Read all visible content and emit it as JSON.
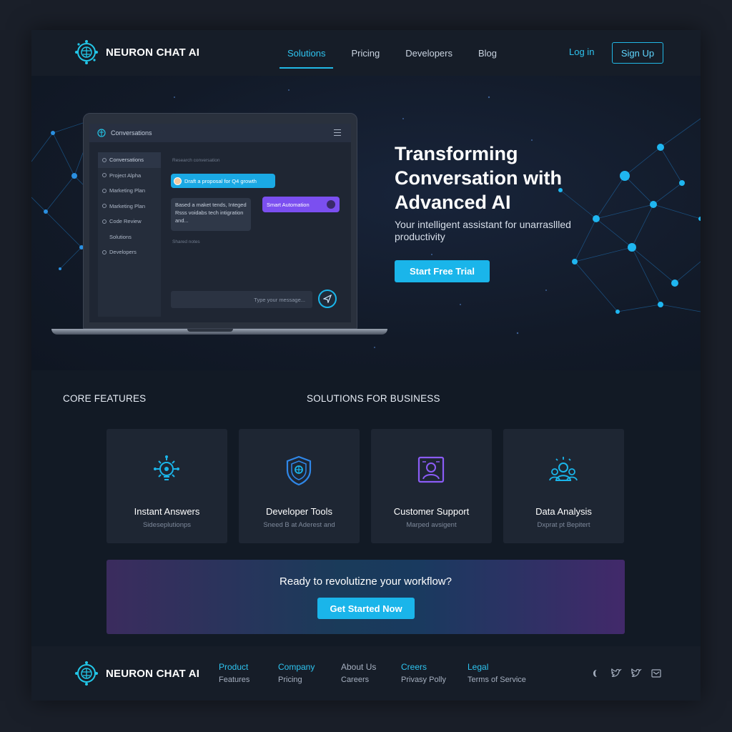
{
  "brand": {
    "name": "NEURON CHAT AI"
  },
  "nav": {
    "links": [
      "Solutions",
      "Pricing",
      "Developers",
      "Blog"
    ],
    "active": "Solutions",
    "login": "Log in",
    "signup": "Sign Up"
  },
  "hero": {
    "title": "Transforming Conversation with Advanced AI",
    "subtitle": "Your intelligent assistant for unarrasllled productivity",
    "cta": "Start Free Trial"
  },
  "app_mock": {
    "title": "Conversations",
    "sidebar": [
      "Conversations",
      "Project Alpha",
      "Marketing Plan",
      "Marketing Plan",
      "Code Review",
      "Solutions",
      "Developers"
    ],
    "chat_hint": "Research conversation",
    "user_message": "Draft a proposal for Q4 growth",
    "ai_message": "Based a maket tends, Integed Rsss voidabs tech intigration and...",
    "automation_chip": "Smart Automation",
    "small_note": "Shared notes",
    "input_placeholder": "Type your message..."
  },
  "features": {
    "label_left": "CORE FEATURES",
    "label_right": "SOLUTIONS FOR BUSINESS",
    "cards": [
      {
        "title": "Instant Answers",
        "sub": "Sideseplutionps",
        "icon": "bulb-network-icon"
      },
      {
        "title": "Developer Tools",
        "sub": "Sneed B at Aderest and",
        "icon": "shield-brain-icon"
      },
      {
        "title": "Customer Support",
        "sub": "Marped avsigent",
        "icon": "agent-screen-icon"
      },
      {
        "title": "Data Analysis",
        "sub": "Dxprat pt Bepitert",
        "icon": "team-network-icon"
      }
    ]
  },
  "cta_band": {
    "text": "Ready to revolutizne your workflow?",
    "button": "Get Started Now"
  },
  "footer": {
    "brand": "NEURON CHAT AI",
    "columns": [
      {
        "head": "Product",
        "item": "Features"
      },
      {
        "head": "Company",
        "item": "Pricing"
      },
      {
        "head": "About Us",
        "item": "Careers"
      },
      {
        "head": "Creers",
        "item": "Privasy Polly"
      },
      {
        "head": "Legal",
        "item": "Terms of Service"
      }
    ],
    "social": [
      "moon-icon",
      "twitter-icon",
      "twitter-icon",
      "mail-icon"
    ]
  },
  "colors": {
    "accent": "#1ab5ea",
    "purple": "#7b4ff0",
    "bg": "#151b25"
  }
}
